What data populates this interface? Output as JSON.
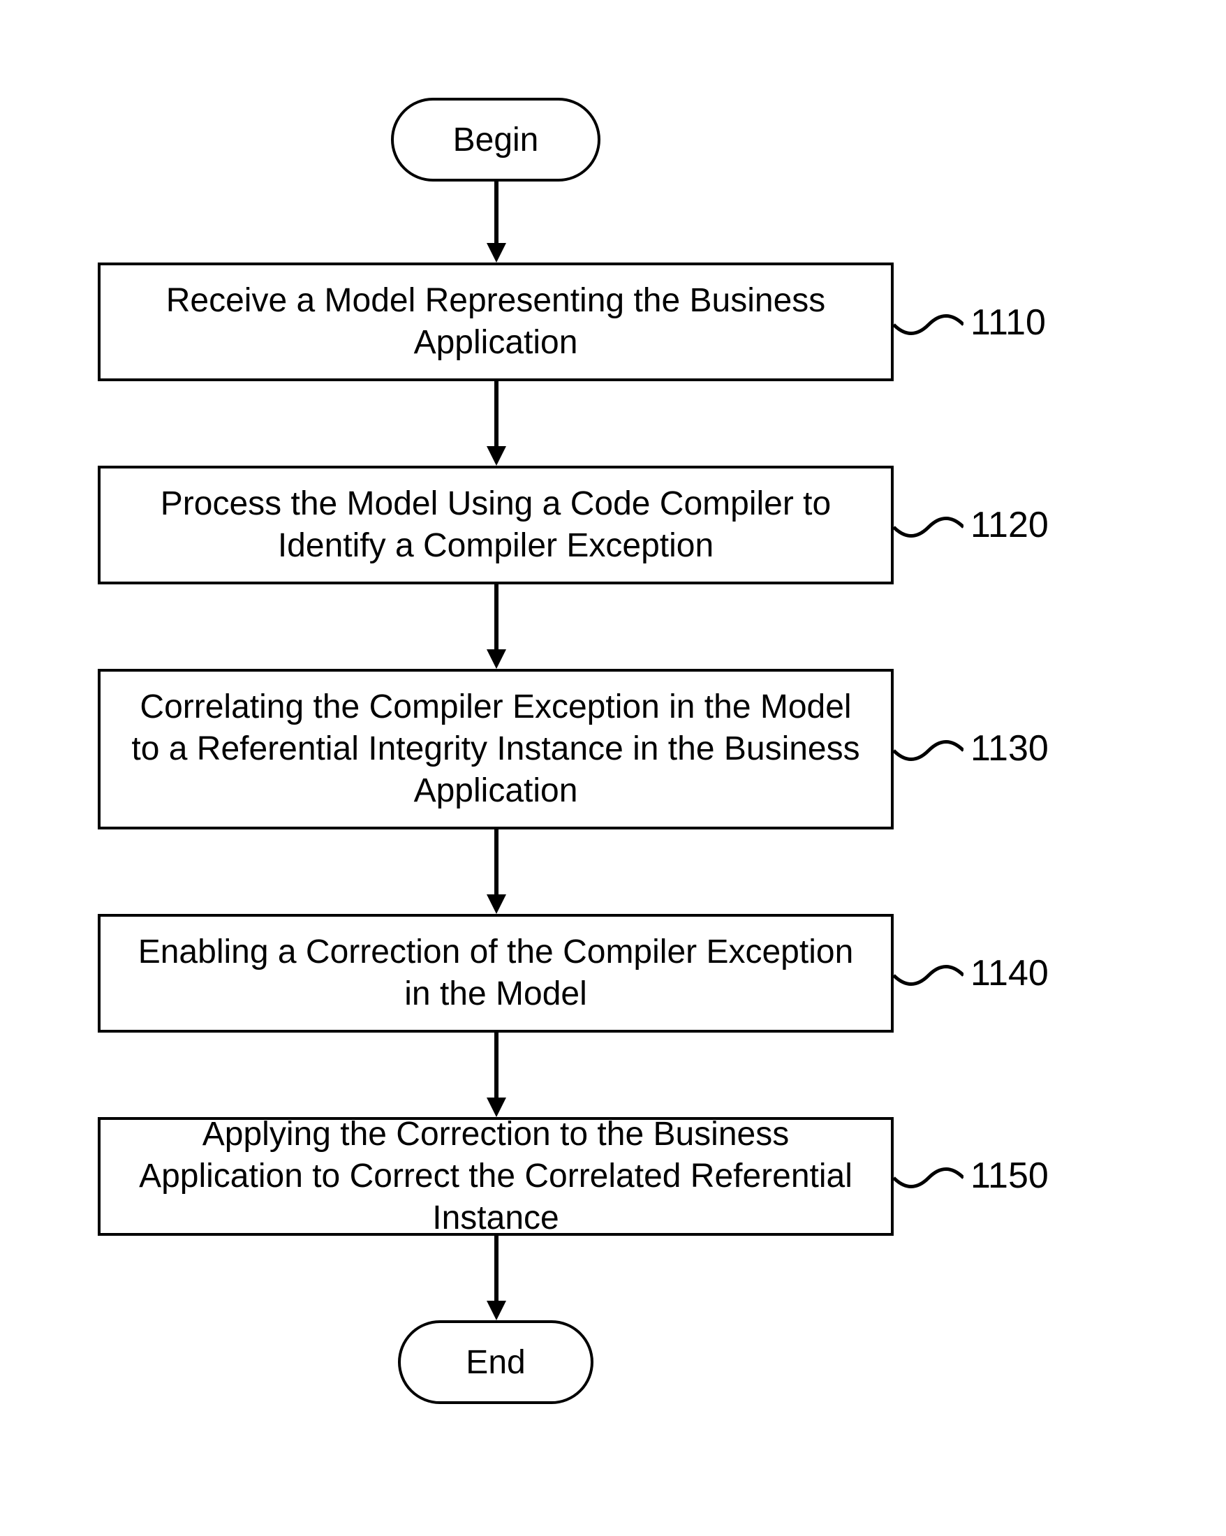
{
  "chart_data": {
    "type": "flowchart",
    "title": "",
    "nodes": [
      {
        "id": "begin",
        "type": "terminator",
        "label": "Begin"
      },
      {
        "id": "n1110",
        "type": "process",
        "label": "Receive a Model Representing the Business Application",
        "ref": "1110"
      },
      {
        "id": "n1120",
        "type": "process",
        "label": "Process the Model Using a Code Compiler to Identify a Compiler Exception",
        "ref": "1120"
      },
      {
        "id": "n1130",
        "type": "process",
        "label": "Correlating the Compiler Exception in the Model to a Referential Integrity Instance in the Business Application",
        "ref": "1130"
      },
      {
        "id": "n1140",
        "type": "process",
        "label": "Enabling a Correction of the Compiler Exception in the Model",
        "ref": "1140"
      },
      {
        "id": "n1150",
        "type": "process",
        "label": "Applying the Correction to the Business Application to Correct the Correlated Referential Instance",
        "ref": "1150"
      },
      {
        "id": "end",
        "type": "terminator",
        "label": "End"
      }
    ],
    "edges": [
      {
        "from": "begin",
        "to": "n1110"
      },
      {
        "from": "n1110",
        "to": "n1120"
      },
      {
        "from": "n1120",
        "to": "n1130"
      },
      {
        "from": "n1130",
        "to": "n1140"
      },
      {
        "from": "n1140",
        "to": "n1150"
      },
      {
        "from": "n1150",
        "to": "end"
      }
    ]
  },
  "flow": {
    "begin": "Begin",
    "end": "End",
    "step1110": {
      "text": "Receive a Model Representing the Business Application",
      "ref": "1110"
    },
    "step1120": {
      "text": "Process the Model Using a Code Compiler to Identify a Compiler Exception",
      "ref": "1120"
    },
    "step1130": {
      "text": "Correlating the Compiler Exception in the Model to a Referential Integrity Instance in the Business Application",
      "ref": "1130"
    },
    "step1140": {
      "text": "Enabling a Correction of the Compiler Exception in the Model",
      "ref": "1140"
    },
    "step1150": {
      "text": "Applying the Correction to the Business Application to Correct the Correlated Referential Instance",
      "ref": "1150"
    }
  }
}
